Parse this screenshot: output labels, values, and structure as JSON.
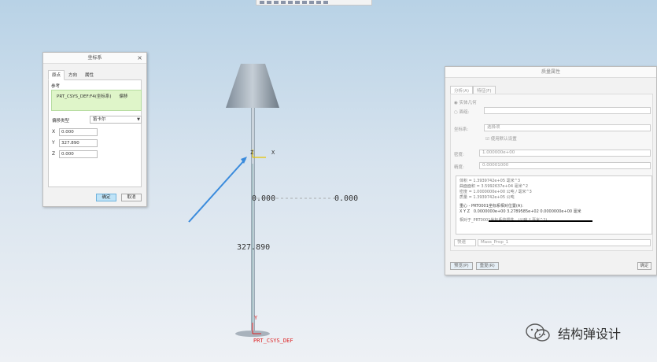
{
  "toolbar": {
    "icons": [
      "toolbar-icons"
    ]
  },
  "viewport": {
    "dim_horizontal_left": "0.000",
    "dim_horizontal_right": "0.000",
    "dim_vertical": "327.890",
    "csys_label": "PRT_CSYS_DEF",
    "axis_x": "X",
    "axis_y": "Y",
    "axis_z": "Z"
  },
  "left_dialog": {
    "title": "坐标系",
    "tabs": [
      "原点",
      "方向",
      "属性"
    ],
    "reference_label": "参考",
    "reference_name": "PRT_CSYS_DEF:F4(坐标系)",
    "reference_type": "偏移",
    "offset_type_label": "偏移类型",
    "offset_type_value": "笛卡尔",
    "x_label": "X",
    "x_value": "0.000",
    "y_label": "Y",
    "y_value": "327.890",
    "z_label": "Z",
    "z_value": "0.000",
    "ok_label": "确定",
    "cancel_label": "取消"
  },
  "right_dialog": {
    "title": "质量属性",
    "tabs": [
      "分析(A)",
      "特征(F)"
    ],
    "solid_geometry": "实体几何",
    "quilt": "面组:",
    "csys_label": "坐标系:",
    "csys_value": "选择项",
    "use_default": "使用默认设置",
    "density_label": "密度:",
    "density_value": "1.000000e+00",
    "accuracy_label": "精度:",
    "accuracy_value": "0.00001000",
    "results": [
      "体积 = 1.3939742e+05 毫米^3",
      "曲面面积 = 3.5992637e+04 毫米^2",
      "密度 = 1.0000000e+00 公吨 / 毫米^3",
      "质量 = 1.3939742e+05 公吨"
    ],
    "cog_title": "重心 - PRT0001坐标系相对位置(A):",
    "cog_axes": "X  Y  Z",
    "cog_values": "0.0000000e+00  3.2789585e+02  0.0000000e+00  毫米",
    "inertia_note": "相对于_PRT0001坐标系的惯性。(公吨 * 毫米^2)",
    "quick_label": "快速",
    "feature_name": "Mass_Prop_1",
    "preview_button": "预览(P)",
    "repeat_button": "重复(R)",
    "close_button": "确定"
  },
  "watermark": {
    "text": "结构弹设计"
  }
}
